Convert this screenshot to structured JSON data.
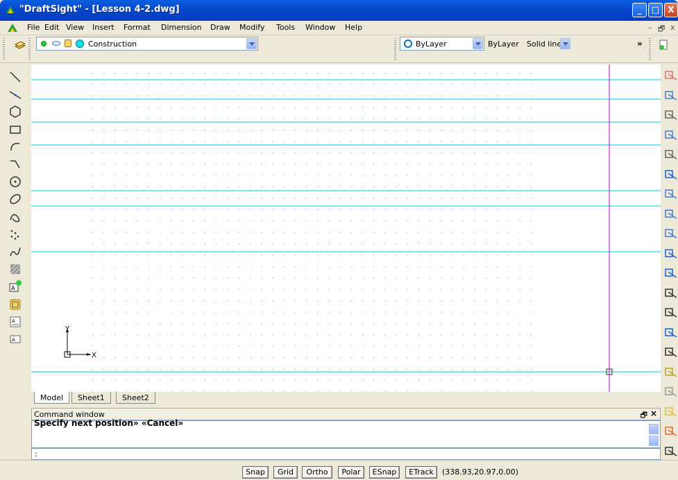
{
  "window": {
    "title": "\"DraftSight\" - [Lesson 4-2.dwg]",
    "minimize": "_",
    "maximize": "□",
    "close": "X"
  },
  "menu": {
    "items": [
      "File",
      "Edit",
      "View",
      "Insert",
      "Format",
      "Dimension",
      "Draw",
      "Modify",
      "Tools",
      "Window",
      "Help"
    ],
    "mdi_min": "–",
    "mdi_restore": "🗗",
    "mdi_close": "x"
  },
  "toolbar": {
    "layer_name": "Construction",
    "color_value": "ByLayer",
    "linetype_value": "ByLayer",
    "lineweight_value": "Solid line",
    "overflow": "»"
  },
  "tabs": [
    "Model",
    "Sheet1",
    "Sheet2"
  ],
  "ucs": {
    "x_label": "X",
    "y_label": "Y"
  },
  "command_window": {
    "title": "Command window",
    "output": "Specify next position» «Cancel»",
    "prompt": ":"
  },
  "status": {
    "buttons": [
      "Snap",
      "Grid",
      "Ortho",
      "Polar",
      "ESnap",
      "ETrack"
    ],
    "coordinates": "(338.93,20.97,0.00)"
  },
  "colors": {
    "construction_line": "#00c8e0",
    "vertical_line": "#c000c0",
    "grid_dot": "#888888"
  },
  "icons": {
    "left_toolbar": [
      "line-icon",
      "infinite-line-icon",
      "polygon-icon",
      "rectangle-icon",
      "arc-icon",
      "polyline-icon",
      "circle-icon",
      "ellipse-icon",
      "spline-icon",
      "point-icon",
      "freehand-icon",
      "hatch-icon",
      "text-icon",
      "block-icon",
      "note-icon",
      "simple-note-icon"
    ],
    "right_toolbar": [
      "erase-icon",
      "copy-icon",
      "mirror-icon",
      "offset-icon",
      "pattern-icon",
      "move-icon",
      "rotate-icon",
      "scale-icon",
      "stretch-icon",
      "trim-icon",
      "extend-icon",
      "fillet-icon",
      "chamfer-icon",
      "break-icon",
      "join-icon",
      "explode-icon",
      "edit-icon",
      "properties-icon",
      "sticky-icon",
      "bomb-icon"
    ]
  }
}
